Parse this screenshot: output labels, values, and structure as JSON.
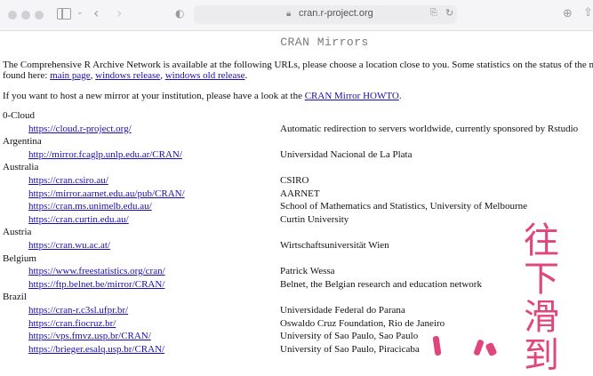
{
  "browser": {
    "url": "cran.r-project.org"
  },
  "page": {
    "title": "CRAN Mirrors",
    "intro_text": "The Comprehensive R Archive Network is available at the following URLs, please choose a location close to you. Some statistics on the status of the m",
    "found_here": "found here: ",
    "link_main_page": "main page",
    "sep1": ", ",
    "link_windows_release": "windows release",
    "sep2": ", ",
    "link_windows_old_release": "windows old release",
    "end_period": ".",
    "host_text": "If you want to host a new mirror at your institution, please have a look at the ",
    "link_howto": "CRAN Mirror HOWTO",
    "host_end": "."
  },
  "mirrors": [
    {
      "country": "0-Cloud",
      "url": "https://cloud.r-project.org/",
      "desc": "Automatic redirection to servers worldwide, currently sponsored by Rstudio"
    },
    {
      "country": "Argentina",
      "url": "http://mirror.fcaglp.unlp.edu.ar/CRAN/",
      "desc": "Universidad Nacional de La Plata"
    },
    {
      "country": "Australia",
      "url": "https://cran.csiro.au/",
      "desc": "CSIRO"
    },
    {
      "country": "",
      "url": "https://mirror.aarnet.edu.au/pub/CRAN/",
      "desc": "AARNET"
    },
    {
      "country": "",
      "url": "https://cran.ms.unimelb.edu.au/",
      "desc": "School of Mathematics and Statistics, University of Melbourne"
    },
    {
      "country": "",
      "url": "https://cran.curtin.edu.au/",
      "desc": "Curtin University"
    },
    {
      "country": "Austria",
      "url": "https://cran.wu.ac.at/",
      "desc": "Wirtschaftsuniversität Wien"
    },
    {
      "country": "Belgium",
      "url": "https://www.freestatistics.org/cran/",
      "desc": "Patrick Wessa"
    },
    {
      "country": "",
      "url": "https://ftp.belnet.be/mirror/CRAN/",
      "desc": "Belnet, the Belgian research and education network"
    },
    {
      "country": "Brazil",
      "url": "https://cran-r.c3sl.ufpr.br/",
      "desc": "Universidade Federal do Parana"
    },
    {
      "country": "",
      "url": "https://cran.fiocruz.br/",
      "desc": "Oswaldo Cruz Foundation, Rio de Janeiro"
    },
    {
      "country": "",
      "url": "https://vps.fmvz.usp.br/CRAN/",
      "desc": "University of Sao Paulo, Sao Paulo"
    },
    {
      "country": "",
      "url": "https://brieger.esalq.usp.br/CRAN/",
      "desc": "University of Sao Paulo, Piracicaba"
    }
  ],
  "overlay": {
    "text": "往下滑到"
  },
  "icons": {
    "lock": "lock-icon",
    "back": "chevron-left-icon",
    "forward": "chevron-right-icon",
    "download": "download-icon",
    "share": "share-icon"
  },
  "colors": {
    "link": "#1a0dab",
    "overlay": "#e0457b"
  }
}
